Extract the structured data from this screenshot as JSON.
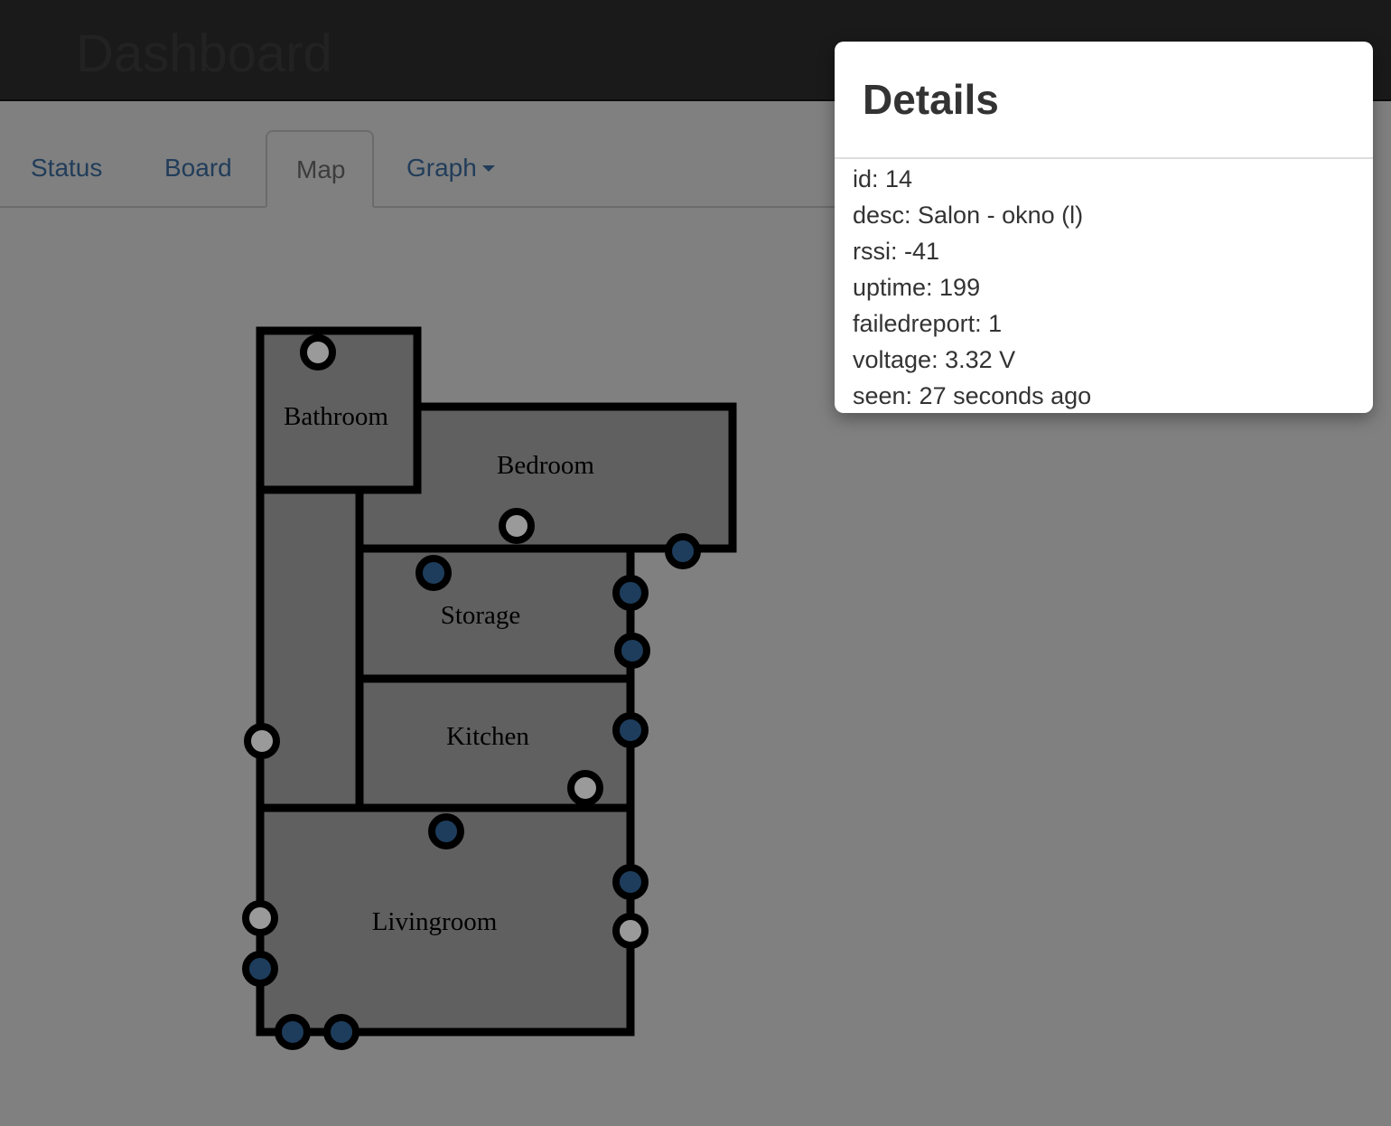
{
  "app": {
    "brand": "Dashboard"
  },
  "tabs": [
    {
      "label": "Status",
      "active": false
    },
    {
      "label": "Board",
      "active": false
    },
    {
      "label": "Map",
      "active": true
    },
    {
      "label": "Graph",
      "active": false,
      "dropdown": true
    }
  ],
  "map": {
    "rooms": [
      "Bathroom",
      "Bedroom",
      "Storage",
      "Kitchen",
      "Livingroom"
    ],
    "sensor_states": {
      "open_color": "#9a9a9a",
      "closed_color": "#1e3d5c",
      "wall_color": "#000000",
      "room_fill": "#606060"
    }
  },
  "details": {
    "title": "Details",
    "rows": [
      "id: 14",
      "desc: Salon - okno (l)",
      "rssi: -41",
      "uptime: 199",
      "failedreport: 1",
      "voltage: 3.32 V",
      "seen: 27 seconds ago"
    ]
  }
}
